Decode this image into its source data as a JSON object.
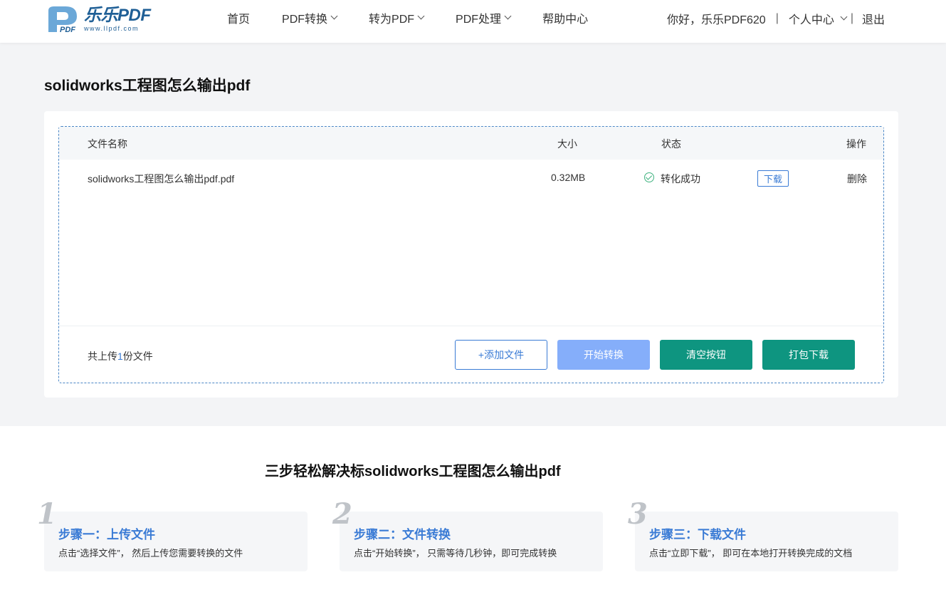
{
  "header": {
    "logo": {
      "brand": "乐乐PDF",
      "url": "www.llpdf.com",
      "mark": "PDF"
    },
    "nav": [
      {
        "label": "首页",
        "has_dropdown": false
      },
      {
        "label": "PDF转换",
        "has_dropdown": true
      },
      {
        "label": "转为PDF",
        "has_dropdown": true
      },
      {
        "label": "PDF处理",
        "has_dropdown": true
      },
      {
        "label": "帮助中心",
        "has_dropdown": false
      }
    ],
    "greeting": "你好，乐乐PDF620",
    "separator": "|",
    "user_center": "个人中心",
    "logout": "退出"
  },
  "page": {
    "title": "solidworks工程图怎么输出pdf"
  },
  "table": {
    "headers": {
      "name": "文件名称",
      "size": "大小",
      "status": "状态",
      "action": "操作"
    },
    "rows": [
      {
        "name": "solidworks工程图怎么输出pdf.pdf",
        "size": "0.32MB",
        "status": "转化成功",
        "download": "下载",
        "delete": "删除"
      }
    ]
  },
  "footer_bar": {
    "count_prefix": "共上传",
    "count": "1",
    "count_suffix": "份文件"
  },
  "buttons": {
    "add": "+添加文件",
    "start": "开始转换",
    "clear": "清空按钮",
    "pack": "打包下载"
  },
  "steps_section": {
    "title": "三步轻松解决标solidworks工程图怎么输出pdf",
    "steps": [
      {
        "num": "1",
        "title": "步骤一：上传文件",
        "desc": "点击“选择文件”， 然后上传您需要转换的文件"
      },
      {
        "num": "2",
        "title": "步骤二：文件转换",
        "desc": "点击“开始转换”， 只需等待几秒钟，即可完成转换"
      },
      {
        "num": "3",
        "title": "步骤三：下载文件",
        "desc": "点击“立即下载”， 即可在本地打开转换完成的文档"
      }
    ]
  },
  "colors": {
    "accent": "#3a7bd5",
    "teal": "#0e9580",
    "start_disabled": "#85aefa",
    "success": "#3fb27f",
    "bg_grey": "#f3f4f6"
  }
}
